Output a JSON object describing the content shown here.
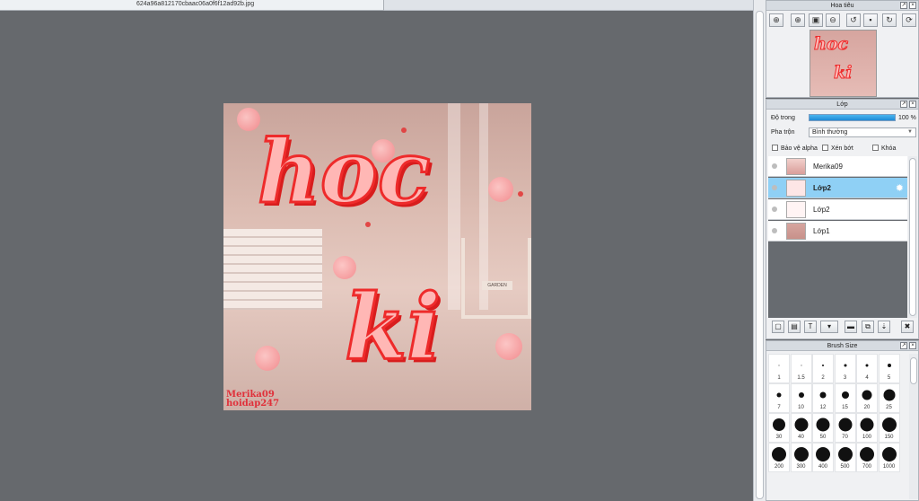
{
  "tab": {
    "filename": "624a96a812170cbaac06a0f6f12ad92b.jpg"
  },
  "canvas": {
    "line1": "hoc",
    "line2": "ki",
    "watermark1": "Merika09",
    "watermark2": "hoidap247",
    "sign": "GARDEN"
  },
  "navigator": {
    "title": "Hoa tiêu",
    "tools": [
      "zoom-in",
      "zoom-in-plus",
      "fit",
      "zoom-out",
      "rotate-left",
      "actual-size",
      "rotate-right"
    ],
    "mini1": "hoc",
    "mini2": "ki"
  },
  "layers": {
    "title": "Lớp",
    "opacity_label": "Độ trong",
    "opacity_value": "100 %",
    "opacity": 1.0,
    "blend_label": "Pha trộn",
    "blend_value": "Bình thường",
    "options": [
      "Bảo vệ alpha",
      "Xén bớt",
      "Khóa"
    ],
    "items": [
      {
        "name": "Merika09",
        "selected": false
      },
      {
        "name": "Lớp2",
        "selected": true
      },
      {
        "name": "Lớp2",
        "selected": false
      },
      {
        "name": "Lớp1",
        "selected": false
      }
    ]
  },
  "brush": {
    "title": "Brush Size",
    "sizes": [
      "1",
      "1.5",
      "2",
      "3",
      "4",
      "5",
      "7",
      "10",
      "12",
      "15",
      "20",
      "25",
      "30",
      "40",
      "50",
      "70",
      "100",
      "150",
      "200",
      "300",
      "400",
      "500",
      "700",
      "1000"
    ]
  },
  "colors": {
    "accent": "#1e8ad6",
    "selected_row": "#8fd0f5",
    "lettering": "#ee2b2b"
  }
}
